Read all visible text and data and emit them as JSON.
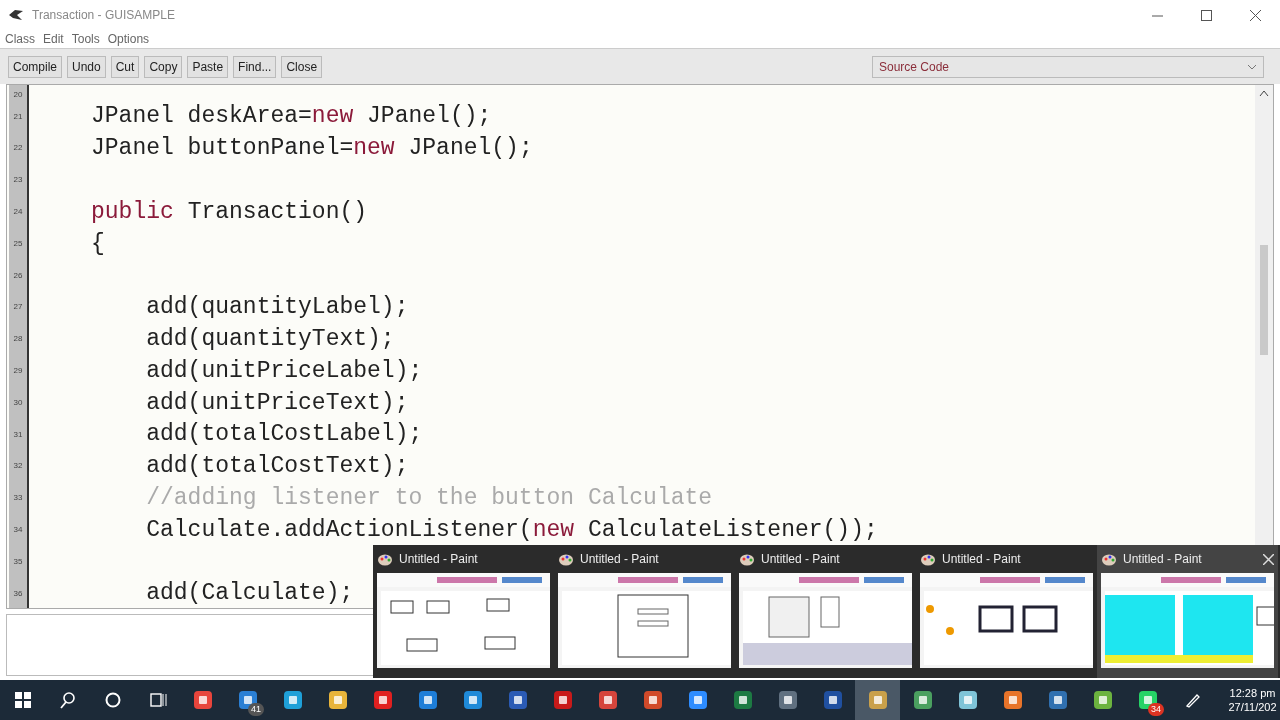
{
  "window": {
    "title": "Transaction - GUISAMPLE"
  },
  "menu": [
    "Class",
    "Edit",
    "Tools",
    "Options"
  ],
  "toolbar": [
    "Compile",
    "Undo",
    "Cut",
    "Copy",
    "Paste",
    "Find...",
    "Close"
  ],
  "view_select": {
    "value": "Source Code"
  },
  "editor": {
    "lines": [
      {
        "number": "20"
      },
      {
        "number": "21",
        "segments": [
          {
            "kind": "plain",
            "text": "JPanel deskArea="
          },
          {
            "kind": "keyword",
            "text": "new"
          },
          {
            "kind": "plain",
            "text": " JPanel();"
          }
        ]
      },
      {
        "number": "22",
        "segments": [
          {
            "kind": "plain",
            "text": "JPanel buttonPanel="
          },
          {
            "kind": "keyword",
            "text": "new"
          },
          {
            "kind": "plain",
            "text": " JPanel();"
          }
        ]
      },
      {
        "number": "23"
      },
      {
        "number": "24",
        "segments": [
          {
            "kind": "keyword",
            "text": "public"
          },
          {
            "kind": "plain",
            "text": " Transaction()"
          }
        ]
      },
      {
        "number": "25",
        "segments": [
          {
            "kind": "plain",
            "text": "{"
          }
        ]
      },
      {
        "number": "26"
      },
      {
        "number": "27",
        "segments": [
          {
            "kind": "plain",
            "text": "    add(quantityLabel);"
          }
        ]
      },
      {
        "number": "28",
        "segments": [
          {
            "kind": "plain",
            "text": "    add(quantityText);"
          }
        ]
      },
      {
        "number": "29",
        "segments": [
          {
            "kind": "plain",
            "text": "    add(unitPriceLabel);"
          }
        ]
      },
      {
        "number": "30",
        "segments": [
          {
            "kind": "plain",
            "text": "    add(unitPriceText);"
          }
        ]
      },
      {
        "number": "31",
        "segments": [
          {
            "kind": "plain",
            "text": "    add(totalCostLabel);"
          }
        ]
      },
      {
        "number": "32",
        "segments": [
          {
            "kind": "plain",
            "text": "    add(totalCostText);"
          }
        ]
      },
      {
        "number": "33",
        "segments": [
          {
            "kind": "comment",
            "text": "    //adding listener to the button Calculate"
          }
        ]
      },
      {
        "number": "34",
        "segments": [
          {
            "kind": "plain",
            "text": "    Calculate.addActionListener("
          },
          {
            "kind": "keyword",
            "text": "new"
          },
          {
            "kind": "plain",
            "text": " CalculateListener());"
          }
        ]
      },
      {
        "number": "35"
      },
      {
        "number": "36",
        "segments": [
          {
            "kind": "plain",
            "text": "    add(Calculate);"
          }
        ]
      }
    ]
  },
  "taskbar_popup": {
    "thumbnails": [
      {
        "title": "Untitled - Paint",
        "selected": false
      },
      {
        "title": "Untitled - Paint",
        "selected": false
      },
      {
        "title": "Untitled - Paint",
        "selected": false
      },
      {
        "title": "Untitled - Paint",
        "selected": false
      },
      {
        "title": "Untitled - Paint",
        "selected": true
      }
    ]
  },
  "taskbar": {
    "apps": [
      {
        "active": false
      },
      {
        "active": false,
        "badge": "41"
      },
      {
        "active": false
      },
      {
        "active": false
      },
      {
        "active": false
      },
      {
        "active": false
      },
      {
        "active": false
      },
      {
        "active": false
      },
      {
        "active": false
      },
      {
        "active": false
      },
      {
        "active": false
      },
      {
        "active": false
      },
      {
        "active": false
      },
      {
        "active": false
      },
      {
        "active": false
      },
      {
        "active": true
      },
      {
        "active": false
      },
      {
        "active": false
      },
      {
        "active": false
      },
      {
        "active": false
      },
      {
        "active": false
      },
      {
        "active": false,
        "badge": "34"
      }
    ],
    "clock": {
      "time": "12:28 pm",
      "date": "27/11/202"
    }
  }
}
